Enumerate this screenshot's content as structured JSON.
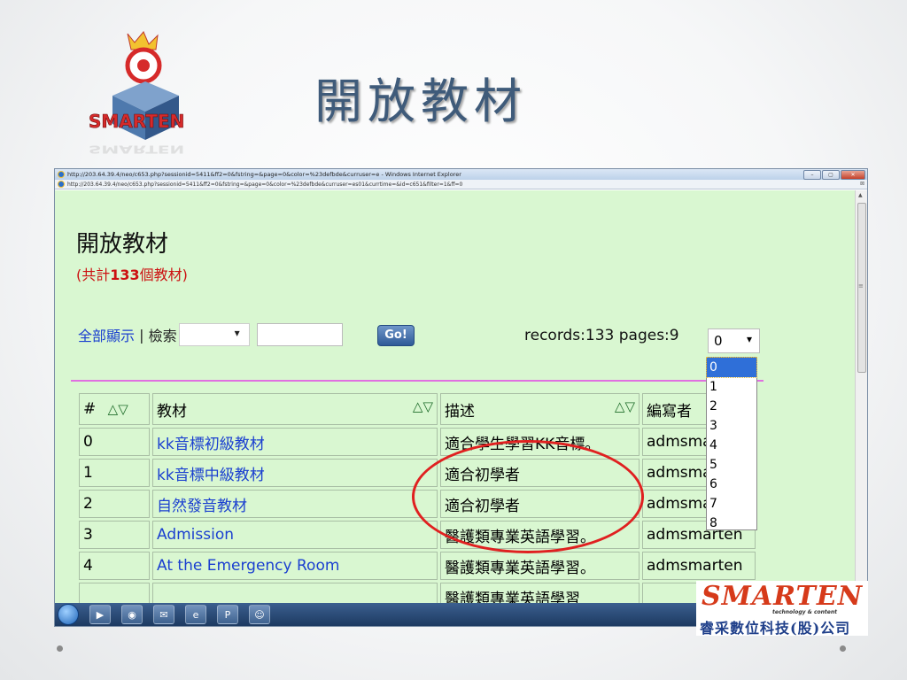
{
  "slide": {
    "title": "開放教材",
    "logo_text": "SMARTEN"
  },
  "browser": {
    "window_title": "http://203.64.39.4/neo/c653.php?sessionid=5411&ff2=0&fstring=&page=0&color=%23defbde&curruser=e - Windows Internet Explorer",
    "address": "http://203.64.39.4/neo/c653.php?sessionid=5411&ff2=0&fstring=&page=0&color=%23defbde&curruser=es01&currtime=&id=c651&filter=1&ff=0"
  },
  "page": {
    "heading": "開放教材",
    "count_open": "(共計",
    "count_num": "133",
    "count_close": "個教材)",
    "show_all": "全部顯示",
    "separator": " | ",
    "search_label": "檢索",
    "go_label": "Go!",
    "records": "records:133 pages:9",
    "page_selected": "0",
    "page_options": [
      "0",
      "1",
      "2",
      "3",
      "4",
      "5",
      "6",
      "7",
      "8"
    ]
  },
  "table": {
    "headers": [
      "#",
      "教材",
      "描述",
      "編寫者"
    ],
    "rows": [
      {
        "num": "0",
        "title": "kk音標初級教材",
        "desc": "適合學生學習KK音標。",
        "author": "admsmarten"
      },
      {
        "num": "1",
        "title": "kk音標中級教材",
        "desc": "適合初學者",
        "author": "admsmarten"
      },
      {
        "num": "2",
        "title": "自然發音教材",
        "desc": "適合初學者",
        "author": "admsmarten"
      },
      {
        "num": "3",
        "title": "Admission",
        "desc": "醫護類專業英語學習。",
        "author": "admsmarten"
      },
      {
        "num": "4",
        "title": "At the Emergency Room",
        "desc": "醫護類專業英語學習。",
        "author": "admsmarten"
      },
      {
        "num": "",
        "title": "",
        "desc": "醫護類專業英語學習",
        "author": ""
      }
    ]
  },
  "brand": {
    "name": "SMARTEN",
    "tagline": "technology & content",
    "company": "睿采數位科技(股)公司"
  },
  "colors": {
    "content_bg": "#d9f7d1",
    "link": "#1a3fd0",
    "count_red": "#cc1111",
    "annotation": "#e02020"
  }
}
